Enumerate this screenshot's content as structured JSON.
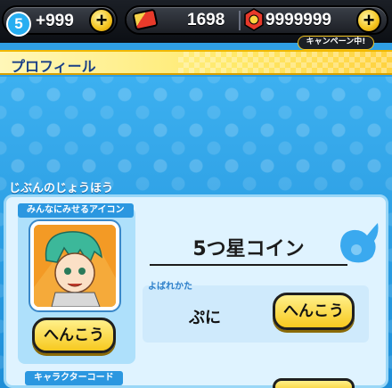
{
  "currency": {
    "level": "5",
    "stamina": "+999",
    "tickets": "1698",
    "gems": "9999999",
    "campaign_tag": "キャンペーン中!"
  },
  "header": {
    "title": "プロフィール"
  },
  "profile": {
    "section_label": "じぶんのじょうほう",
    "icon_tab_label": "みんなにみせるアイコン",
    "icon_change_button": "へんこう",
    "coin_name": "5つ星コイン",
    "nickname_label": "よばれかた",
    "nickname": "ぷに",
    "nickname_change_button": "へんこう",
    "character_code_label": "キャラクターコード"
  },
  "colors": {
    "accent_blue": "#2b97e0",
    "button_yellow": "#f7c91f",
    "banner_yellow": "#ffe96a"
  }
}
